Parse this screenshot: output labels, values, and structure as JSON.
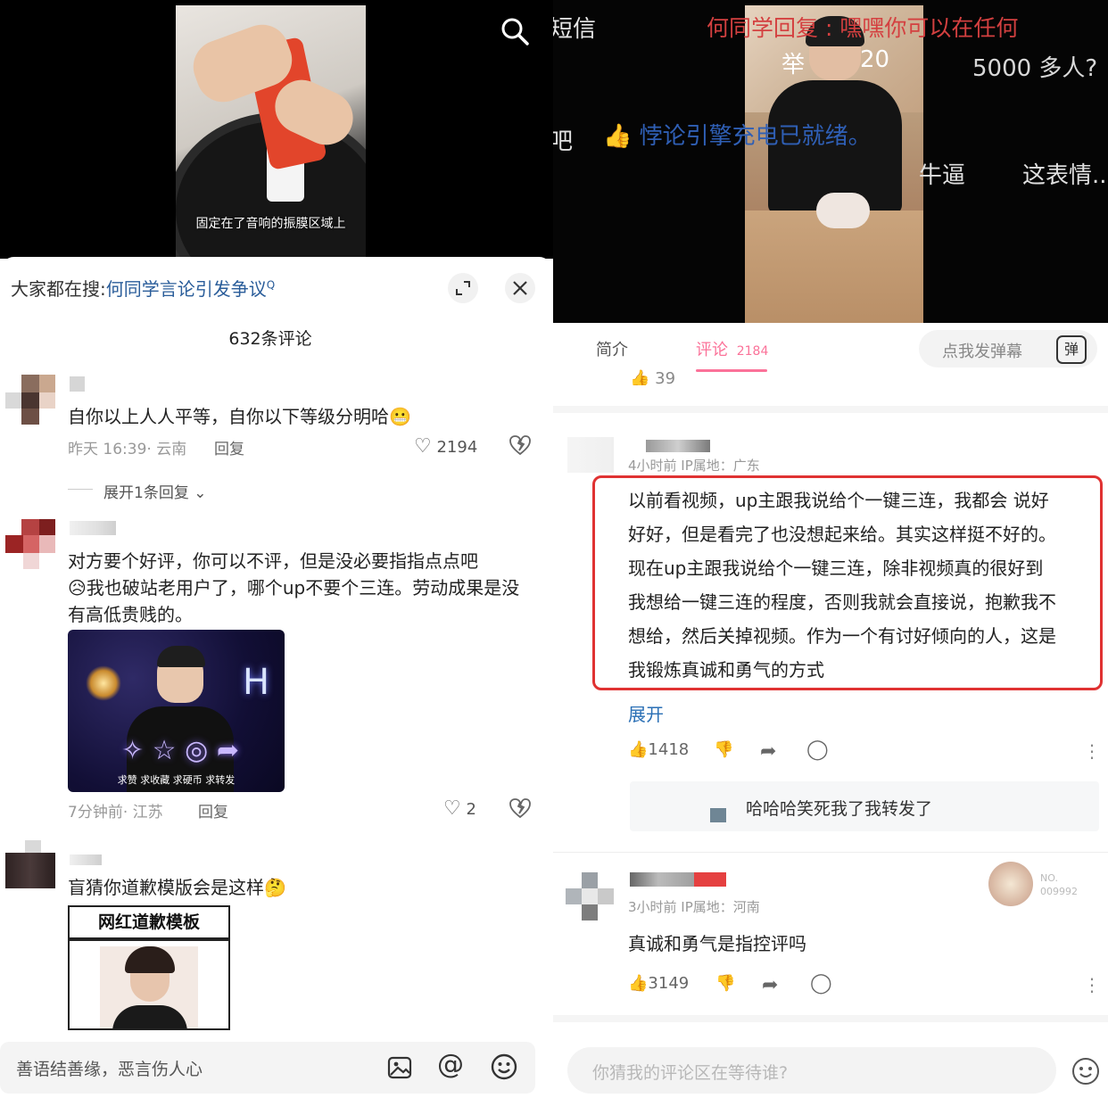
{
  "left": {
    "video_caption": "固定在了音响的振膜区域上",
    "search": {
      "prefix": "大家都在搜:",
      "query": "何同学言论引发争议",
      "query_icon": "Q"
    },
    "comment_count": "632条评论",
    "comments": [
      {
        "text": "自你以上人人平等，自你以下等级分明哈",
        "emoji": "😬",
        "time": "昨天 16:39",
        "region": "· 云南",
        "reply": "回复",
        "likes": "2194",
        "expand": "展开1条回复"
      },
      {
        "text": "对方要个好评，你可以不评，但是没必要指指点点吧",
        "emoji": "😥",
        "text2": "我也破站老用户了，哪个up不要个三连。劳动成果是没有高低贵贱的。",
        "image_caption": "求赞 求收藏 求硬币 求转发",
        "image_letter": "H",
        "time": "7分钟前",
        "region": "· 江苏",
        "reply": "回复",
        "likes": "2"
      },
      {
        "text": "盲猜你道歉模版会是这样",
        "emoji": "🤔",
        "meme_title": "网红道歉模板"
      }
    ],
    "input_placeholder": "善语结善缘，恶言伤人心"
  },
  "right": {
    "danmaku": [
      {
        "text": "短信",
        "color": "#e8e8e8"
      },
      {
        "text": "何同学回复 : 嘿嘿你可以在任何",
        "color": "#d44040"
      },
      {
        "text": "5000 多人?",
        "color": "#d8d8d8"
      },
      {
        "text": "吧",
        "color": "#e0e0e0"
      },
      {
        "text": "悖论引擎充电已就绪。",
        "color": "#2f5fb5"
      },
      {
        "text": "牛逼",
        "color": "#e0e0e0"
      },
      {
        "text": "这表情..",
        "color": "#e0e0e0"
      },
      {
        "text": "举",
        "color": "#ffffff"
      },
      {
        "text": "20",
        "color": "#ffffff"
      }
    ],
    "tabs": {
      "intro": "简介",
      "comments": "评论",
      "comments_count": "2184"
    },
    "danmaku_placeholder": "点我发弹幕",
    "danmaku_button": "弹",
    "top_partial_likes": "39",
    "comments": [
      {
        "meta": "4小时前  IP属地：广东",
        "lines": [
          "以前看视频，up主跟我说给个一键三连，我都会 说好",
          "好好，但是看完了也没想起来给。其实这样挺不好的。",
          "现在up主跟我说给个一键三连，除非视频真的很好到",
          "我想给一键三连的程度，否则我就会直接说，抱歉我不",
          "想给，然后关掉视频。作为一个有讨好倾向的人，这是",
          "我锻炼真诚和勇气的方式"
        ],
        "expand": "展开",
        "likes": "1418",
        "sub_reply": "哈哈哈笑死我了我转发了"
      },
      {
        "meta": "3小时前  IP属地：河南",
        "badge_no": "NO.",
        "badge_num": "009992",
        "text": "真诚和勇气是指控评吗",
        "likes": "3149"
      }
    ],
    "input_placeholder": "你猜我的评论区在等待谁?"
  },
  "colors": {
    "link_blue": "#2a5d9a",
    "bili_pink": "#fb7299",
    "highlight_red": "#e03232"
  }
}
